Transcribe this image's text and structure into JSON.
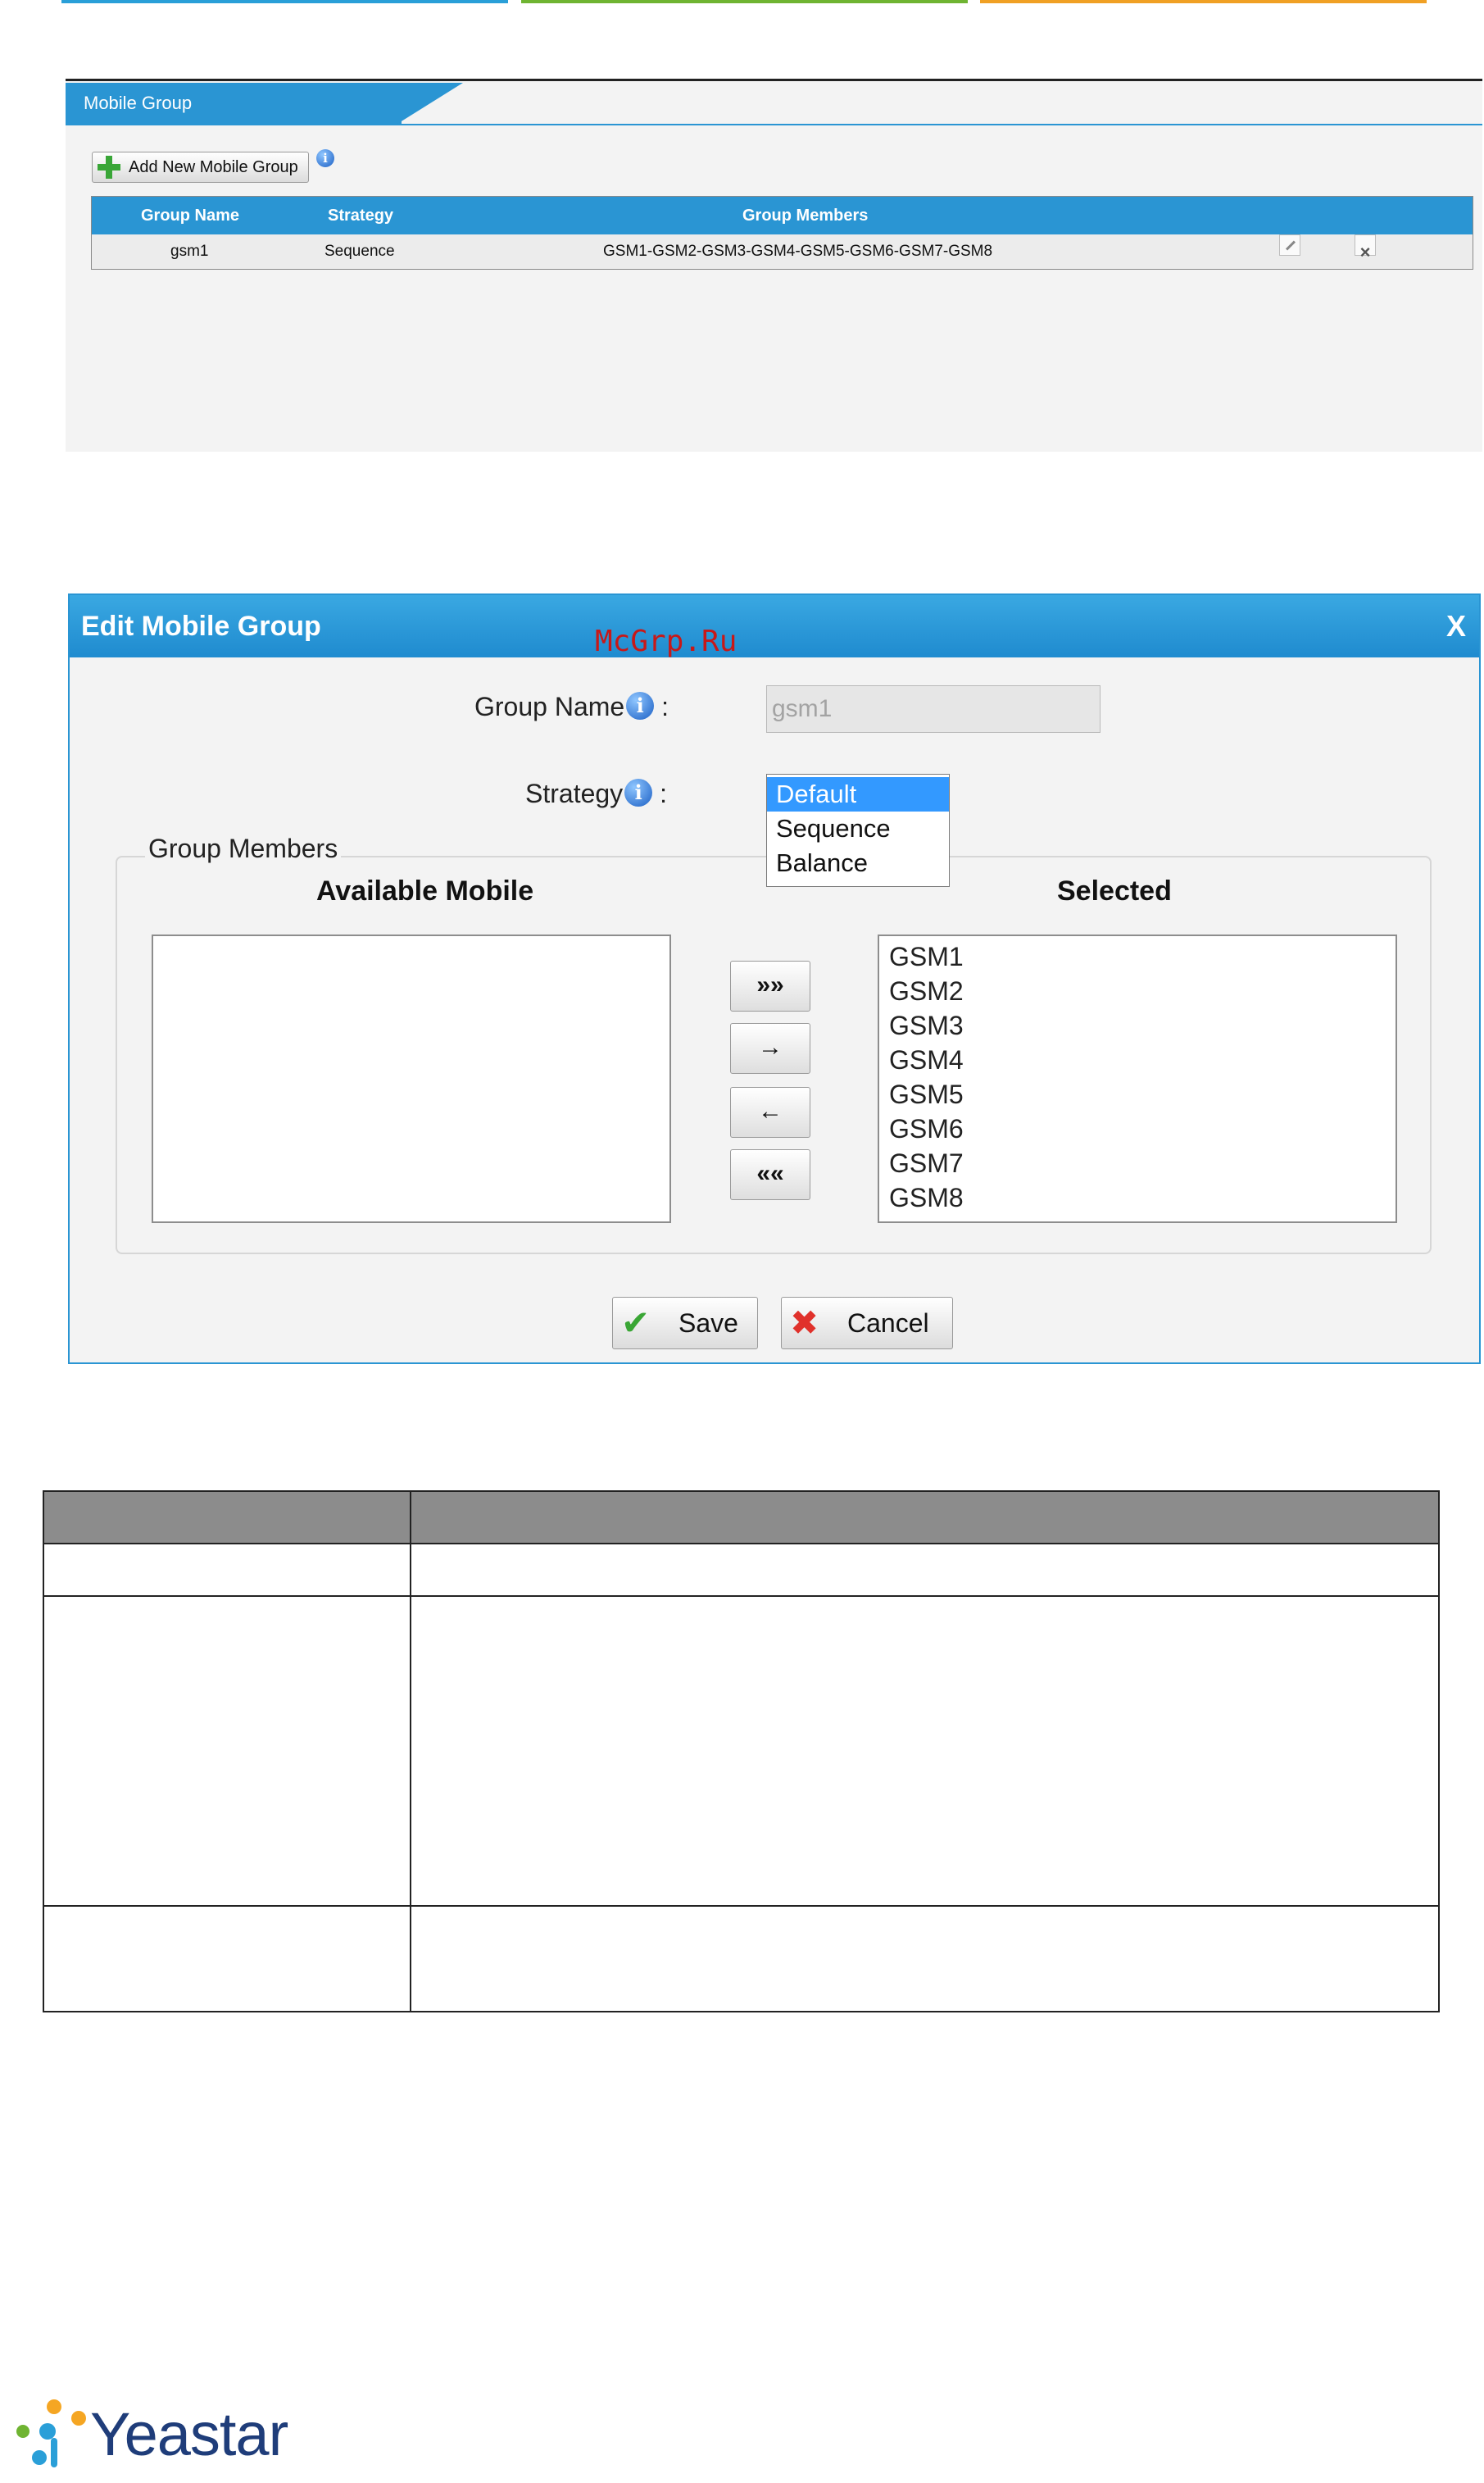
{
  "mobile_group_panel": {
    "tab_title": "Mobile Group",
    "add_button_label": "Add New Mobile Group",
    "info_glyph": "i",
    "columns": [
      "Group Name",
      "Strategy",
      "Group Members"
    ],
    "rows": [
      {
        "name": "gsm1",
        "strategy": "Sequence",
        "members": "GSM1-GSM2-GSM3-GSM4-GSM5-GSM6-GSM7-GSM8"
      }
    ],
    "icons": {
      "edit": "edit-icon",
      "delete": "delete-icon",
      "add": "plus-icon",
      "info": "info-icon"
    },
    "accent_color": "#2a95d3"
  },
  "edit_dialog": {
    "title": "Edit Mobile Group",
    "close_label": "X",
    "group_name_label": "Group Name",
    "group_name_value": "gsm1",
    "strategy_label": "Strategy",
    "colon": ":",
    "info_glyph": "i",
    "strategy_options": [
      "Default",
      "Sequence",
      "Balance"
    ],
    "strategy_selected": "Default",
    "group_members_legend": "Group Members",
    "available_heading": "Available Mobile",
    "selected_heading": "Selected",
    "available_items": [],
    "selected_items": [
      "GSM1",
      "GSM2",
      "GSM3",
      "GSM4",
      "GSM5",
      "GSM6",
      "GSM7",
      "GSM8"
    ],
    "move_buttons": [
      "»»",
      "→",
      "←",
      "««"
    ],
    "save_label": "Save",
    "cancel_label": "Cancel",
    "save_glyph": "✔",
    "cancel_glyph": "✖"
  },
  "watermark": "McGrp.Ru",
  "logo_text": "Yeastar",
  "top_bar_colors": [
    "#2a9fd8",
    "#6fb432",
    "#f0a024"
  ]
}
